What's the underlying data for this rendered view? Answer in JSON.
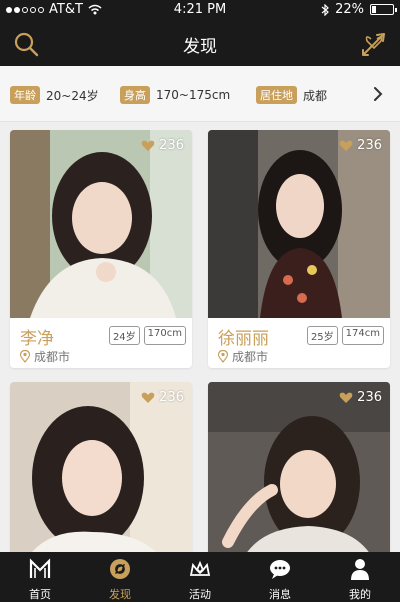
{
  "status_bar": {
    "carrier": "AT&T",
    "time": "4:21 PM",
    "battery": "22%",
    "battery_level": 0.22
  },
  "header": {
    "title": "发现"
  },
  "filters": [
    {
      "tag": "年龄",
      "value": "20~24岁"
    },
    {
      "tag": "身高",
      "value": "170~175cm"
    },
    {
      "tag": "居住地",
      "value": "成都"
    }
  ],
  "cards": [
    {
      "name": "李净",
      "age": "24岁",
      "height": "170cm",
      "city": "成都市",
      "likes": "236"
    },
    {
      "name": "徐丽丽",
      "age": "25岁",
      "height": "174cm",
      "city": "成都市",
      "likes": "236"
    },
    {
      "likes": "236"
    },
    {
      "likes": "236"
    }
  ],
  "tabs": [
    {
      "label": "首页",
      "icon": "home-m-icon"
    },
    {
      "label": "发现",
      "icon": "discover-icon",
      "active": true
    },
    {
      "label": "活动",
      "icon": "activity-crown-icon"
    },
    {
      "label": "消息",
      "icon": "message-icon"
    },
    {
      "label": "我的",
      "icon": "profile-icon"
    }
  ],
  "colors": {
    "accent": "#c9a05b",
    "bar": "#1a1a1a",
    "background": "#efefef"
  }
}
